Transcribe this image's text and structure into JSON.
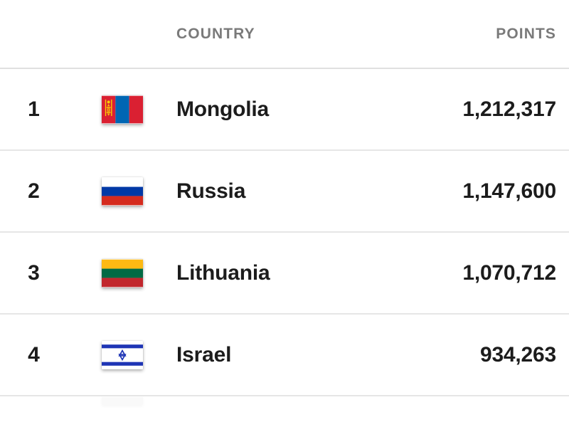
{
  "header": {
    "rank_label": "",
    "flag_label": "",
    "country_label": "COUNTRY",
    "points_label": "POINTS"
  },
  "colors": {
    "text": "#1c1c1c",
    "header_text": "#7a7a7a",
    "divider": "#e6e6e6",
    "background": "#ffffff"
  },
  "rows": [
    {
      "rank": "1",
      "country": "Mongolia",
      "points": "1,212,317",
      "flag": "flag-mongolia-icon"
    },
    {
      "rank": "2",
      "country": "Russia",
      "points": "1,147,600",
      "flag": "flag-russia-icon"
    },
    {
      "rank": "3",
      "country": "Lithuania",
      "points": "1,070,712",
      "flag": "flag-lithuania-icon"
    },
    {
      "rank": "4",
      "country": "Israel",
      "points": "934,263",
      "flag": "flag-israel-icon"
    },
    {
      "rank": "",
      "country": "",
      "points": "",
      "flag": "flag-partial-icon"
    }
  ]
}
